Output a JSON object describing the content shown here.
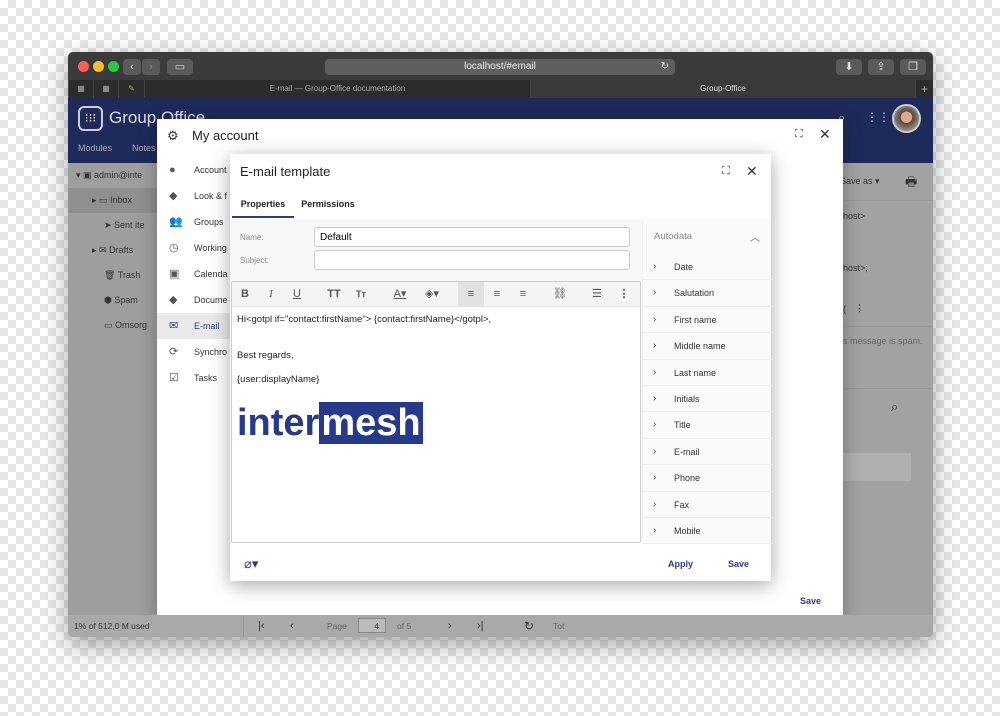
{
  "browser": {
    "url": "localhost/#email",
    "tabs": [
      "E-mail — Group-Office documentation",
      "Group-Office"
    ],
    "new_tab": "+"
  },
  "app": {
    "name": "Group Office",
    "nav": [
      "Modules",
      "Notes"
    ],
    "toolbar": {
      "save_as": "Save as"
    }
  },
  "mail_sidebar": {
    "account": "admin@inte",
    "folders": [
      "Inbox",
      "Sent ite",
      "Drafts",
      "Trash",
      "Spam",
      "Omsorg"
    ]
  },
  "mail_preview": {
    "lines": [
      "host>",
      "host>;",
      "(",
      "s message is spam."
    ]
  },
  "my_account": {
    "title": "My account",
    "nav": [
      {
        "label": "Account",
        "icon": "account-circle-icon"
      },
      {
        "label": "Look & f",
        "icon": "palette-icon"
      },
      {
        "label": "Groups",
        "icon": "groups-icon"
      },
      {
        "label": "Working",
        "icon": "clock-icon"
      },
      {
        "label": "Calenda",
        "icon": "calendar-icon"
      },
      {
        "label": "Docume",
        "icon": "documents-icon"
      },
      {
        "label": "E-mail",
        "icon": "email-icon",
        "active": true
      },
      {
        "label": "Synchro",
        "icon": "sync-icon"
      },
      {
        "label": "Tasks",
        "icon": "tasks-icon"
      }
    ],
    "save": "Save"
  },
  "template": {
    "title": "E-mail template",
    "tabs": [
      "Properties",
      "Permissions"
    ],
    "active_tab": "Properties",
    "name_label": "Name:",
    "name_value": "Default",
    "subject_label": "Subject:",
    "subject_value": "",
    "body": [
      "Hi<gotpl if=\"contact:firstName\"> {contact:firstName}</gotpl>,",
      "Best regards,",
      "{user:displayName}"
    ],
    "logo": {
      "part1": "inter",
      "part2": "mesh",
      "color": "#27398a"
    },
    "autodata_title": "Autodata",
    "autodata": [
      "Date",
      "Salutation",
      "First name",
      "Middle name",
      "Last name",
      "Initials",
      "Title",
      "E-mail",
      "Phone",
      "Fax",
      "Mobile"
    ],
    "apply": "Apply",
    "save": "Save"
  },
  "statusbar": {
    "quota": "1% of 512,0 M used",
    "page_label": "Page",
    "page": "4",
    "of": "of 5",
    "total": "Tot"
  },
  "colors": {
    "accent": "#1e2a5a",
    "link": "#2b3a8c"
  }
}
